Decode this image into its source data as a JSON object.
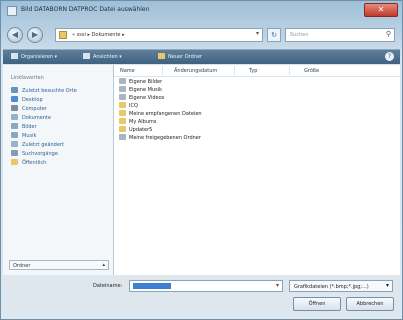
{
  "window": {
    "title": "Bild DATABORN DATPROC Datei auswählen",
    "close_glyph": "✕"
  },
  "nav": {
    "back_glyph": "◀",
    "forward_glyph": "▶",
    "address_path": "« sssi ▸ Dokumente ▸",
    "search_placeholder": "Suchen",
    "search_icon": "search-icon"
  },
  "toolbar": {
    "items": [
      "Organisieren ▾",
      "Ansichten ▾",
      "Neuer Ordner"
    ],
    "help_glyph": "?"
  },
  "sidebar": {
    "heading": "Linkfavoriten",
    "items": [
      {
        "label": "Zuletzt besuchte Orte",
        "color": "#6a93c4"
      },
      {
        "label": "Desktop",
        "color": "#4f8bd0"
      },
      {
        "label": "Computer",
        "color": "#7f8c99"
      },
      {
        "label": "Dokumente",
        "color": "#9ab2c9"
      },
      {
        "label": "Bilder",
        "color": "#8aa7c2"
      },
      {
        "label": "Musik",
        "color": "#8aa7c2"
      },
      {
        "label": "Zuletzt geändert",
        "color": "#9ab2c9"
      },
      {
        "label": "Suchvorgänge",
        "color": "#7f9db8"
      },
      {
        "label": "Öffentlich",
        "color": "#e7c76a"
      }
    ],
    "folders_label": "Ordner"
  },
  "columns": [
    "Name",
    "Änderungsdatum",
    "Typ",
    "Größe"
  ],
  "files": [
    {
      "name": "Eigene Bilder",
      "color": "#a9b6c2"
    },
    {
      "name": "Eigene Musik",
      "color": "#a9b6c2"
    },
    {
      "name": "Eigene Videos",
      "color": "#a9b6c2"
    },
    {
      "name": "ICQ",
      "color": "#e7c76a"
    },
    {
      "name": "Meine empfangenen Dateien",
      "color": "#e7c76a"
    },
    {
      "name": "My Albums",
      "color": "#e7c76a"
    },
    {
      "name": "Updater5",
      "color": "#e7c76a"
    },
    {
      "name": "Meine freigegebenen Ordner",
      "color": "#a9b6c2"
    }
  ],
  "bottom": {
    "filename_label": "Dateiname:",
    "filetype_value": "Grafikdateien (*.bmp;*.jpg;...)",
    "open_label": "Öffnen",
    "cancel_label": "Abbrechen"
  }
}
